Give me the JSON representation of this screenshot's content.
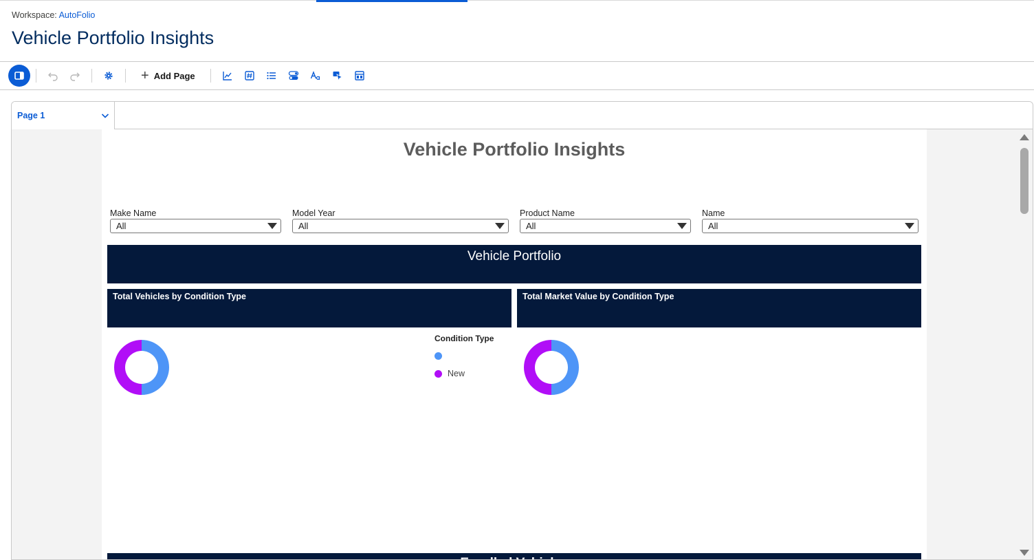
{
  "header": {
    "workspace_label": "Workspace:",
    "workspace_name": "AutoFolio",
    "title": "Vehicle Portfolio Insights"
  },
  "toolbar": {
    "add_page_label": "Add Page"
  },
  "tabs": {
    "current_page": "Page 1"
  },
  "dashboard": {
    "title": "Vehicle Portfolio Insights",
    "filters": [
      {
        "label": "Make Name",
        "value": "All"
      },
      {
        "label": "Model Year",
        "value": "All"
      },
      {
        "label": "Product Name",
        "value": "All"
      },
      {
        "label": "Name",
        "value": "All"
      }
    ],
    "section_banner": "Vehicle Portfolio",
    "card_left_title": "Total Vehicles by Condition Type",
    "card_right_title": "Total Market Value by Condition Type",
    "legend_title": "Condition Type",
    "bottom_banner": "Enrolled Vehicles"
  },
  "colors": {
    "accent": "#0b5cd5",
    "navy": "#04193b",
    "series_blank": "#4e95f7",
    "series_new": "#b10ef7"
  },
  "chart_data": [
    {
      "type": "pie",
      "title": "Total Vehicles by Condition Type",
      "categories": [
        "",
        "New"
      ],
      "values": [
        50,
        50
      ],
      "legend": "right",
      "colors": [
        "#4e95f7",
        "#b10ef7"
      ]
    },
    {
      "type": "pie",
      "title": "Total Market Value by Condition Type",
      "categories": [
        "",
        "New"
      ],
      "values": [
        50,
        50
      ],
      "colors": [
        "#4e95f7",
        "#b10ef7"
      ]
    }
  ]
}
